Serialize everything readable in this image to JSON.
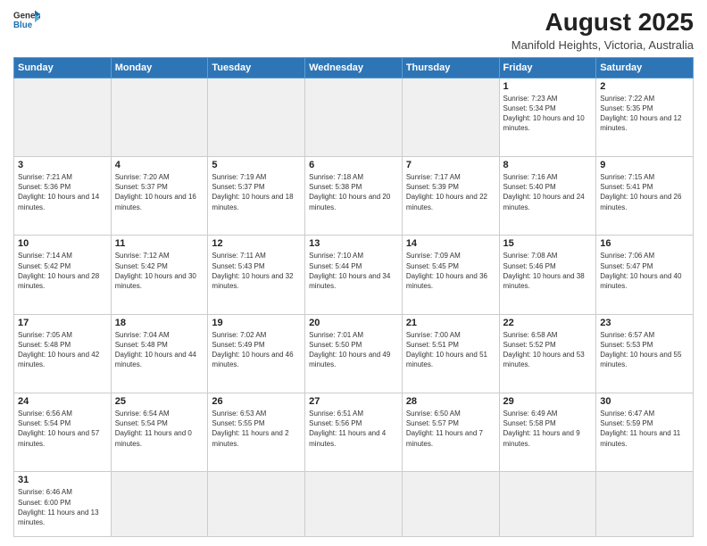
{
  "header": {
    "logo_general": "General",
    "logo_blue": "Blue",
    "title": "August 2025",
    "subtitle": "Manifold Heights, Victoria, Australia"
  },
  "days_of_week": [
    "Sunday",
    "Monday",
    "Tuesday",
    "Wednesday",
    "Thursday",
    "Friday",
    "Saturday"
  ],
  "weeks": [
    [
      {
        "day": "",
        "info": "",
        "empty": true
      },
      {
        "day": "",
        "info": "",
        "empty": true
      },
      {
        "day": "",
        "info": "",
        "empty": true
      },
      {
        "day": "",
        "info": "",
        "empty": true
      },
      {
        "day": "",
        "info": "",
        "empty": true
      },
      {
        "day": "1",
        "info": "Sunrise: 7:23 AM\nSunset: 5:34 PM\nDaylight: 10 hours and 10 minutes."
      },
      {
        "day": "2",
        "info": "Sunrise: 7:22 AM\nSunset: 5:35 PM\nDaylight: 10 hours and 12 minutes."
      }
    ],
    [
      {
        "day": "3",
        "info": "Sunrise: 7:21 AM\nSunset: 5:36 PM\nDaylight: 10 hours and 14 minutes."
      },
      {
        "day": "4",
        "info": "Sunrise: 7:20 AM\nSunset: 5:37 PM\nDaylight: 10 hours and 16 minutes."
      },
      {
        "day": "5",
        "info": "Sunrise: 7:19 AM\nSunset: 5:37 PM\nDaylight: 10 hours and 18 minutes."
      },
      {
        "day": "6",
        "info": "Sunrise: 7:18 AM\nSunset: 5:38 PM\nDaylight: 10 hours and 20 minutes."
      },
      {
        "day": "7",
        "info": "Sunrise: 7:17 AM\nSunset: 5:39 PM\nDaylight: 10 hours and 22 minutes."
      },
      {
        "day": "8",
        "info": "Sunrise: 7:16 AM\nSunset: 5:40 PM\nDaylight: 10 hours and 24 minutes."
      },
      {
        "day": "9",
        "info": "Sunrise: 7:15 AM\nSunset: 5:41 PM\nDaylight: 10 hours and 26 minutes."
      }
    ],
    [
      {
        "day": "10",
        "info": "Sunrise: 7:14 AM\nSunset: 5:42 PM\nDaylight: 10 hours and 28 minutes."
      },
      {
        "day": "11",
        "info": "Sunrise: 7:12 AM\nSunset: 5:42 PM\nDaylight: 10 hours and 30 minutes."
      },
      {
        "day": "12",
        "info": "Sunrise: 7:11 AM\nSunset: 5:43 PM\nDaylight: 10 hours and 32 minutes."
      },
      {
        "day": "13",
        "info": "Sunrise: 7:10 AM\nSunset: 5:44 PM\nDaylight: 10 hours and 34 minutes."
      },
      {
        "day": "14",
        "info": "Sunrise: 7:09 AM\nSunset: 5:45 PM\nDaylight: 10 hours and 36 minutes."
      },
      {
        "day": "15",
        "info": "Sunrise: 7:08 AM\nSunset: 5:46 PM\nDaylight: 10 hours and 38 minutes."
      },
      {
        "day": "16",
        "info": "Sunrise: 7:06 AM\nSunset: 5:47 PM\nDaylight: 10 hours and 40 minutes."
      }
    ],
    [
      {
        "day": "17",
        "info": "Sunrise: 7:05 AM\nSunset: 5:48 PM\nDaylight: 10 hours and 42 minutes."
      },
      {
        "day": "18",
        "info": "Sunrise: 7:04 AM\nSunset: 5:48 PM\nDaylight: 10 hours and 44 minutes."
      },
      {
        "day": "19",
        "info": "Sunrise: 7:02 AM\nSunset: 5:49 PM\nDaylight: 10 hours and 46 minutes."
      },
      {
        "day": "20",
        "info": "Sunrise: 7:01 AM\nSunset: 5:50 PM\nDaylight: 10 hours and 49 minutes."
      },
      {
        "day": "21",
        "info": "Sunrise: 7:00 AM\nSunset: 5:51 PM\nDaylight: 10 hours and 51 minutes."
      },
      {
        "day": "22",
        "info": "Sunrise: 6:58 AM\nSunset: 5:52 PM\nDaylight: 10 hours and 53 minutes."
      },
      {
        "day": "23",
        "info": "Sunrise: 6:57 AM\nSunset: 5:53 PM\nDaylight: 10 hours and 55 minutes."
      }
    ],
    [
      {
        "day": "24",
        "info": "Sunrise: 6:56 AM\nSunset: 5:54 PM\nDaylight: 10 hours and 57 minutes."
      },
      {
        "day": "25",
        "info": "Sunrise: 6:54 AM\nSunset: 5:54 PM\nDaylight: 11 hours and 0 minutes."
      },
      {
        "day": "26",
        "info": "Sunrise: 6:53 AM\nSunset: 5:55 PM\nDaylight: 11 hours and 2 minutes."
      },
      {
        "day": "27",
        "info": "Sunrise: 6:51 AM\nSunset: 5:56 PM\nDaylight: 11 hours and 4 minutes."
      },
      {
        "day": "28",
        "info": "Sunrise: 6:50 AM\nSunset: 5:57 PM\nDaylight: 11 hours and 7 minutes."
      },
      {
        "day": "29",
        "info": "Sunrise: 6:49 AM\nSunset: 5:58 PM\nDaylight: 11 hours and 9 minutes."
      },
      {
        "day": "30",
        "info": "Sunrise: 6:47 AM\nSunset: 5:59 PM\nDaylight: 11 hours and 11 minutes."
      }
    ],
    [
      {
        "day": "31",
        "info": "Sunrise: 6:46 AM\nSunset: 6:00 PM\nDaylight: 11 hours and 13 minutes.",
        "last": true
      },
      {
        "day": "",
        "info": "",
        "empty": true,
        "last": true
      },
      {
        "day": "",
        "info": "",
        "empty": true,
        "last": true
      },
      {
        "day": "",
        "info": "",
        "empty": true,
        "last": true
      },
      {
        "day": "",
        "info": "",
        "empty": true,
        "last": true
      },
      {
        "day": "",
        "info": "",
        "empty": true,
        "last": true
      },
      {
        "day": "",
        "info": "",
        "empty": true,
        "last": true
      }
    ]
  ]
}
